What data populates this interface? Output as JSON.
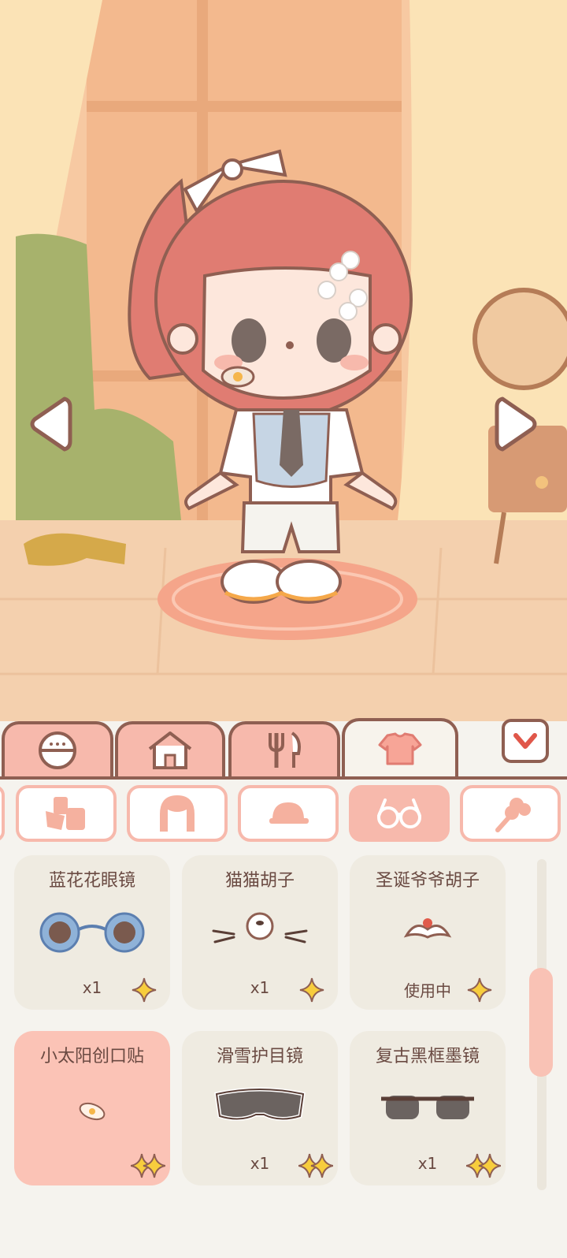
{
  "colors": {
    "accent": "#f7b9ac",
    "outline": "#8f5f52",
    "panel": "#f5f3ee",
    "card": "#efebe1",
    "card_selected": "#fbc3b6",
    "star": "#f7cd3d",
    "hair": "#e07c72"
  },
  "scene": {
    "left_arrow_icon": "chevron-left-icon",
    "right_arrow_icon": "chevron-right-icon"
  },
  "tabs": [
    {
      "icon": "face-icon",
      "active": false
    },
    {
      "icon": "house-icon",
      "active": false
    },
    {
      "icon": "fork-knife-icon",
      "active": false
    },
    {
      "icon": "shirt-icon",
      "active": true
    }
  ],
  "collapse_icon": "chevron-down-icon",
  "subcategories": [
    {
      "icon": "socks-icon",
      "active": false
    },
    {
      "icon": "hair-icon",
      "active": false
    },
    {
      "icon": "hat-icon",
      "active": false
    },
    {
      "icon": "glasses-icon",
      "active": true
    },
    {
      "icon": "hand-item-icon",
      "active": false
    }
  ],
  "items": [
    {
      "name": "蓝花花眼镜",
      "status": "x1",
      "icon": "blue-flower-glasses-icon",
      "selected": false
    },
    {
      "name": "猫猫胡子",
      "status": "x1",
      "icon": "cat-whiskers-icon",
      "selected": false
    },
    {
      "name": "圣诞爷爷胡子",
      "status": "使用中",
      "icon": "santa-beard-icon",
      "selected": false
    },
    {
      "name": "小太阳创口贴",
      "status": "",
      "icon": "sun-bandage-icon",
      "selected": true
    },
    {
      "name": "滑雪护目镜",
      "status": "x1",
      "icon": "ski-goggles-icon",
      "selected": false
    },
    {
      "name": "复古黑框墨镜",
      "status": "x1",
      "icon": "retro-sunglasses-icon",
      "selected": false
    }
  ]
}
